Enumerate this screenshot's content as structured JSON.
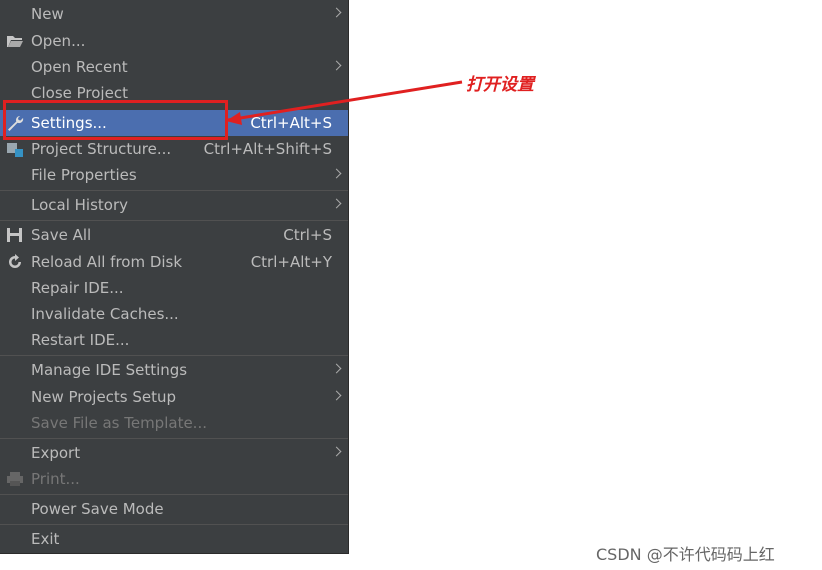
{
  "menu": {
    "items": [
      {
        "label": "New",
        "shortcut": "",
        "submenu": true
      },
      {
        "label": "Open...",
        "shortcut": "",
        "submenu": false,
        "icon": "folder-open-icon"
      },
      {
        "label": "Open Recent",
        "shortcut": "",
        "submenu": true
      },
      {
        "label": "Close Project",
        "shortcut": "",
        "submenu": false
      },
      {
        "label": "Settings...",
        "shortcut": "Ctrl+Alt+S",
        "submenu": false,
        "selected": true,
        "icon": "wrench-icon"
      },
      {
        "label": "Project Structure...",
        "shortcut": "Ctrl+Alt+Shift+S",
        "submenu": false,
        "icon": "project-structure-icon"
      },
      {
        "label": "File Properties",
        "shortcut": "",
        "submenu": true
      },
      {
        "label": "Local History",
        "shortcut": "",
        "submenu": true
      },
      {
        "label": "Save All",
        "shortcut": "Ctrl+S",
        "submenu": false,
        "icon": "save-icon"
      },
      {
        "label": "Reload All from Disk",
        "shortcut": "Ctrl+Alt+Y",
        "submenu": false,
        "icon": "reload-icon"
      },
      {
        "label": "Repair IDE...",
        "shortcut": "",
        "submenu": false
      },
      {
        "label": "Invalidate Caches...",
        "shortcut": "",
        "submenu": false
      },
      {
        "label": "Restart IDE...",
        "shortcut": "",
        "submenu": false
      },
      {
        "label": "Manage IDE Settings",
        "shortcut": "",
        "submenu": true
      },
      {
        "label": "New Projects Setup",
        "shortcut": "",
        "submenu": true
      },
      {
        "label": "Save File as Template...",
        "shortcut": "",
        "submenu": false,
        "disabled": true
      },
      {
        "label": "Export",
        "shortcut": "",
        "submenu": true
      },
      {
        "label": "Print...",
        "shortcut": "",
        "submenu": false,
        "disabled": true,
        "icon": "print-icon"
      },
      {
        "label": "Power Save Mode",
        "shortcut": "",
        "submenu": false
      },
      {
        "label": "Exit",
        "shortcut": "",
        "submenu": false
      }
    ]
  },
  "annotation": {
    "text": "打开设置",
    "color": "#e02020"
  },
  "watermark": "CSDN @不许代码码上红",
  "colors": {
    "menu_bg": "#3c3f41",
    "selected_bg": "#4b6eaf",
    "text": "#bbbbbb",
    "disabled_text": "#777777"
  }
}
